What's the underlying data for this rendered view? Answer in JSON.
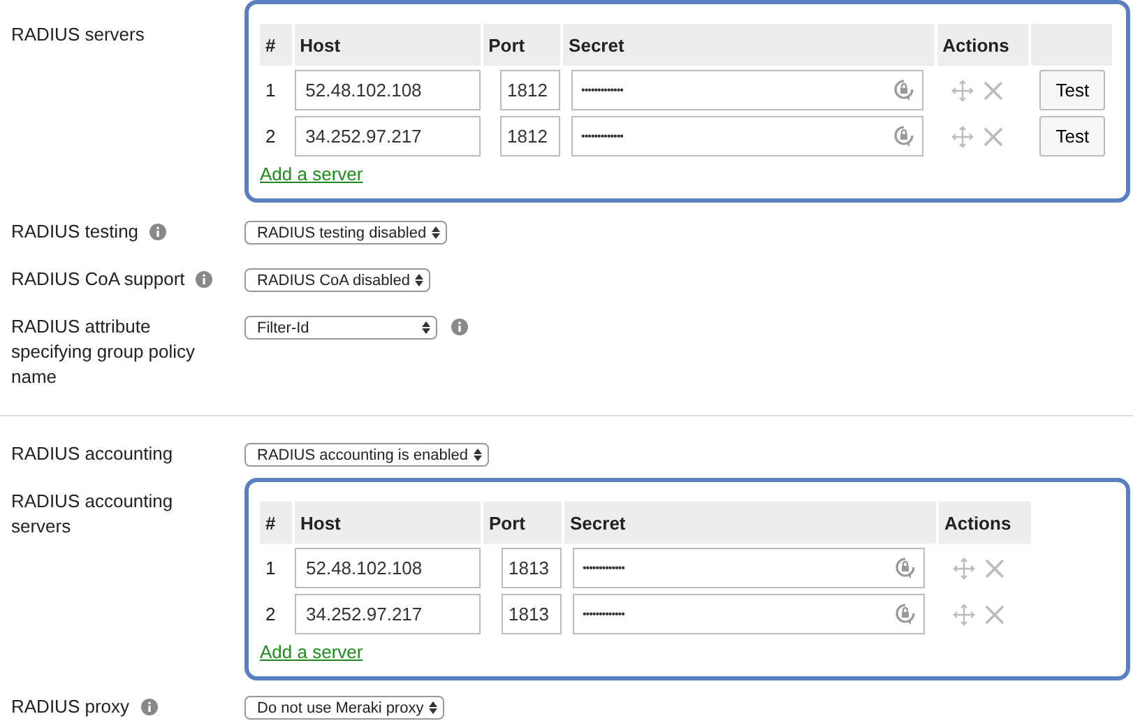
{
  "server_sections": [
    {
      "label": "RADIUS servers",
      "columns": [
        "#",
        "Host",
        "Port",
        "Secret",
        "Actions"
      ],
      "add_link": "Add a server",
      "rows": [
        {
          "index": "1",
          "host": "52.48.102.108",
          "port": "1812",
          "secret": "•••••••••••••",
          "test": "Test"
        },
        {
          "index": "2",
          "host": "34.252.97.217",
          "port": "1812",
          "secret": "•••••••••••••",
          "test": "Test"
        }
      ]
    }
  ],
  "settings": [
    {
      "label": "RADIUS testing",
      "info": true,
      "select": "RADIUS testing disabled",
      "info_after": false
    },
    {
      "label": "RADIUS CoA support",
      "info": true,
      "select": "RADIUS CoA disabled",
      "info_after": false
    },
    {
      "label": "RADIUS attribute specifying group policy name",
      "info": false,
      "select": "Filter-Id",
      "info_after": true,
      "wide": true
    }
  ],
  "accounting": {
    "label": "RADIUS accounting",
    "select": "RADIUS accounting is enabled"
  },
  "accounting_servers": {
    "label": "RADIUS accounting servers",
    "columns": [
      "#",
      "Host",
      "Port",
      "Secret",
      "Actions"
    ],
    "add_link": "Add a server",
    "rows": [
      {
        "index": "1",
        "host": "52.48.102.108",
        "port": "1813",
        "secret": "•••••••••••••"
      },
      {
        "index": "2",
        "host": "34.252.97.217",
        "port": "1813",
        "secret": "•••••••••••••"
      }
    ]
  },
  "proxy": {
    "label": "RADIUS proxy",
    "info": true,
    "select": "Do not use Meraki proxy"
  }
}
